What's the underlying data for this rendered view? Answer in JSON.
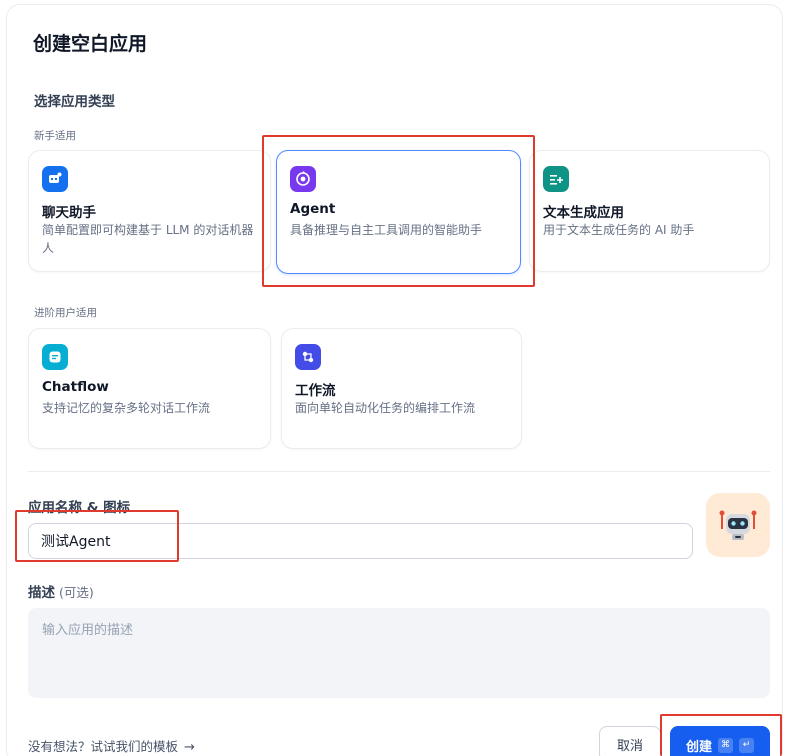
{
  "dialog": {
    "title": "创建空白应用",
    "type_section_label": "选择应用类型",
    "beginner_label": "新手适用",
    "advanced_label": "进阶用户适用"
  },
  "app_types": {
    "chatbot": {
      "title": "聊天助手",
      "desc": "简单配置即可构建基于 LLM 的对话机器人",
      "icon": "chat-bubble-icon",
      "color": "#1570ef"
    },
    "agent": {
      "title": "Agent",
      "desc": "具备推理与自主工具调用的智能助手",
      "icon": "agent-icon",
      "color": "#7839ee",
      "selected": true
    },
    "completion": {
      "title": "文本生成应用",
      "desc": "用于文本生成任务的 AI 助手",
      "icon": "text-generation-icon",
      "color": "#0e9384"
    },
    "chatflow": {
      "title": "Chatflow",
      "desc": "支持记忆的复杂多轮对话工作流",
      "icon": "chatflow-icon",
      "color": "#06aed4"
    },
    "workflow": {
      "title": "工作流",
      "desc": "面向单轮自动化任务的编排工作流",
      "icon": "workflow-icon",
      "color": "#444ce7"
    }
  },
  "form": {
    "name_label": "应用名称 & 图标",
    "name_value": "测试Agent",
    "avatar_icon": "robot-emoji-icon",
    "avatar_bg": "#ffead5",
    "desc_label": "描述",
    "desc_optional": "(可选)",
    "desc_placeholder": "输入应用的描述"
  },
  "footer": {
    "template_link": "没有想法？试试我们的模板",
    "cancel_label": "取消",
    "create_label": "创建",
    "shortcut_cmd": "⌘",
    "shortcut_enter": "↵"
  },
  "colors": {
    "primary": "#155eef",
    "selected_border": "#528bff",
    "highlight_red": "#e03a2f"
  }
}
